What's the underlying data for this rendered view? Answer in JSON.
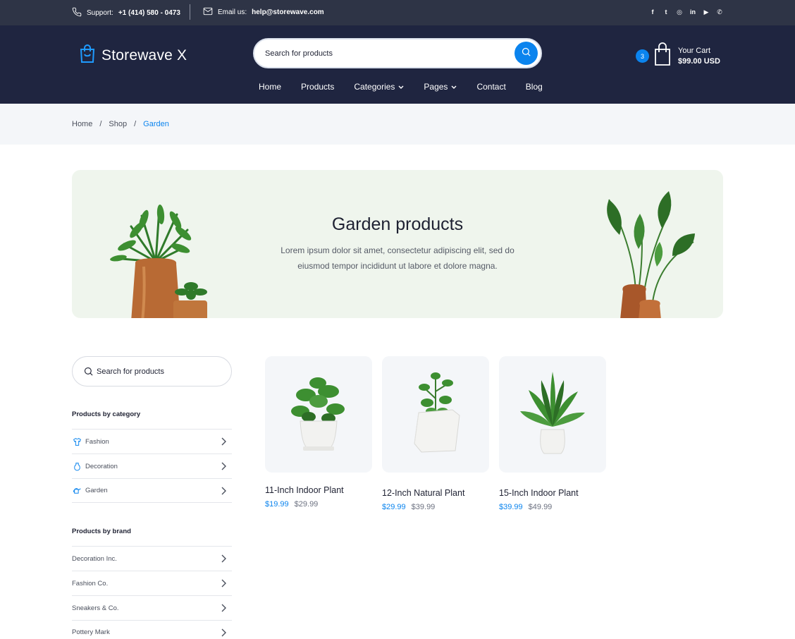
{
  "topbar": {
    "support_label": "Support:",
    "support_phone": "+1 (414) 580 - 0473",
    "email_label": "Email us:",
    "email_value": "help@storewave.com",
    "social": [
      {
        "name": "facebook-icon",
        "glyph": "f"
      },
      {
        "name": "twitter-icon",
        "glyph": "t"
      },
      {
        "name": "instagram-icon",
        "glyph": "◎"
      },
      {
        "name": "linkedin-icon",
        "glyph": "in"
      },
      {
        "name": "youtube-icon",
        "glyph": "▶"
      },
      {
        "name": "whatsapp-icon",
        "glyph": "✆"
      }
    ]
  },
  "header": {
    "brand": "Storewave X",
    "search_placeholder": "Search for products",
    "cart_count": "3",
    "cart_label": "Your Cart",
    "cart_total": "$99.00 USD",
    "nav": [
      {
        "label": "Home",
        "dropdown": false
      },
      {
        "label": "Products",
        "dropdown": false
      },
      {
        "label": "Categories",
        "dropdown": true
      },
      {
        "label": "Pages",
        "dropdown": true
      },
      {
        "label": "Contact",
        "dropdown": false
      },
      {
        "label": "Blog",
        "dropdown": false
      }
    ]
  },
  "breadcrumb": {
    "items": [
      "Home",
      "Shop"
    ],
    "separator": "/",
    "current": "Garden"
  },
  "hero": {
    "title": "Garden products",
    "description": "Lorem ipsum dolor sit amet, consectetur adipiscing elit, sed do eiusmod tempor incididunt ut labore et dolore magna."
  },
  "sidebar": {
    "search_placeholder": "Search for products",
    "category_heading": "Products by category",
    "categories": [
      {
        "label": "Fashion",
        "icon": "shirt-icon"
      },
      {
        "label": "Decoration",
        "icon": "vase-icon"
      },
      {
        "label": "Garden",
        "icon": "watering-can-icon"
      }
    ],
    "brand_heading": "Products by brand",
    "brands": [
      "Decoration Inc.",
      "Fashion Co.",
      "Sneakers & Co.",
      "Pottery Mark"
    ]
  },
  "products": [
    {
      "name": "11-Inch Indoor Plant",
      "sale_price": "$19.99",
      "regular_price": "$29.99"
    },
    {
      "name": "12-Inch Natural Plant",
      "sale_price": "$29.99",
      "regular_price": "$39.99"
    },
    {
      "name": "15-Inch Indoor Plant",
      "sale_price": "$39.99",
      "regular_price": "$49.99"
    }
  ],
  "colors": {
    "topbar_bg": "#2e3446",
    "header_bg": "#1f2540",
    "accent": "#0b84ee",
    "hero_bg": "#eff5ed",
    "breadcrumb_bg": "#f4f6f9"
  }
}
